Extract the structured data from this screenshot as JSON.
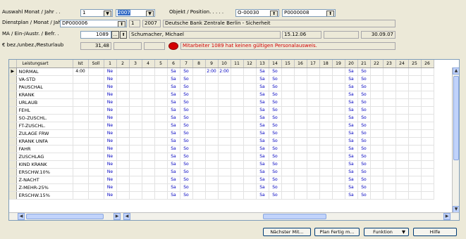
{
  "header": {
    "auswahl_label": "Auswahl Monat / Jahr . .",
    "month_value": "1",
    "year_value": "2007",
    "objekt_label": "Objekt / Position. . . . .",
    "objekt_value": "O-00030",
    "position_value": "P0000008",
    "dienstplan_label": "Dienstplan / Monat / Jahr",
    "dienstplan_value": "DP000006",
    "dp_month": "1",
    "dp_year": "2007",
    "dp_description": "Deutsche Bank Zentrale Berlin - Sicherheit",
    "ma_label": "MA / Ein-/Austr. / Befr. .",
    "ma_value": "1089",
    "ma_name": "Schumacher, Michael",
    "eintritt": "15.12.06",
    "austritt": "30.09.07",
    "urlaub_label": "€ bez./unbez./Resturlaub",
    "urlaub_value": "31,48",
    "warning_text": "Mitarbeiter 1089 hat keinen gültigen Personalausweis.",
    "warning_color": "#d40000"
  },
  "grid": {
    "columns": {
      "leistungsart": "Leistungsart",
      "ist": "Ist",
      "soll": "Soll",
      "days": [
        "1",
        "2",
        "3",
        "4",
        "5",
        "6",
        "7",
        "8",
        "9",
        "10",
        "11",
        "12",
        "13",
        "14",
        "15",
        "16",
        "17",
        "18",
        "19",
        "20",
        "21",
        "22",
        "23",
        "24",
        "25",
        "26"
      ]
    },
    "rows": [
      {
        "name": "NORMAL",
        "ist": "4:00",
        "soll": "",
        "cells": [
          "Ne",
          "",
          "",
          "",
          "",
          "Sa",
          "So",
          "",
          "2:00",
          "2:00",
          "",
          "",
          "Sa",
          "So",
          "",
          "",
          "",
          "",
          "",
          "Sa",
          "So",
          "",
          "",
          "",
          "",
          ""
        ]
      },
      {
        "name": "VA-STD",
        "ist": "",
        "soll": "",
        "cells": [
          "Ne",
          "",
          "",
          "",
          "",
          "Sa",
          "So",
          "",
          "",
          "",
          "",
          "",
          "Sa",
          "So",
          "",
          "",
          "",
          "",
          "",
          "Sa",
          "So",
          "",
          "",
          "",
          "",
          ""
        ]
      },
      {
        "name": "PAUSCHAL",
        "ist": "",
        "soll": "",
        "cells": [
          "Ne",
          "",
          "",
          "",
          "",
          "Sa",
          "So",
          "",
          "",
          "",
          "",
          "",
          "Sa",
          "So",
          "",
          "",
          "",
          "",
          "",
          "Sa",
          "So",
          "",
          "",
          "",
          "",
          ""
        ]
      },
      {
        "name": "KRANK",
        "ist": "",
        "soll": "",
        "cells": [
          "Ne",
          "",
          "",
          "",
          "",
          "Sa",
          "So",
          "",
          "",
          "",
          "",
          "",
          "Sa",
          "So",
          "",
          "",
          "",
          "",
          "",
          "Sa",
          "So",
          "",
          "",
          "",
          "",
          ""
        ]
      },
      {
        "name": "URLAUB",
        "ist": "",
        "soll": "",
        "cells": [
          "Ne",
          "",
          "",
          "",
          "",
          "Sa",
          "So",
          "",
          "",
          "",
          "",
          "",
          "Sa",
          "So",
          "",
          "",
          "",
          "",
          "",
          "Sa",
          "So",
          "",
          "",
          "",
          "",
          ""
        ]
      },
      {
        "name": "FEHL",
        "ist": "",
        "soll": "",
        "cells": [
          "Ne",
          "",
          "",
          "",
          "",
          "Sa",
          "So",
          "",
          "",
          "",
          "",
          "",
          "Sa",
          "So",
          "",
          "",
          "",
          "",
          "",
          "Sa",
          "So",
          "",
          "",
          "",
          "",
          ""
        ]
      },
      {
        "name": "SO-ZUSCHL.",
        "ist": "",
        "soll": "",
        "cells": [
          "Ne",
          "",
          "",
          "",
          "",
          "Sa",
          "So",
          "",
          "",
          "",
          "",
          "",
          "Sa",
          "So",
          "",
          "",
          "",
          "",
          "",
          "Sa",
          "So",
          "",
          "",
          "",
          "",
          ""
        ]
      },
      {
        "name": "FT-ZUSCHL.",
        "ist": "",
        "soll": "",
        "cells": [
          "Ne",
          "",
          "",
          "",
          "",
          "Sa",
          "So",
          "",
          "",
          "",
          "",
          "",
          "Sa",
          "So",
          "",
          "",
          "",
          "",
          "",
          "Sa",
          "So",
          "",
          "",
          "",
          "",
          ""
        ]
      },
      {
        "name": "ZULAGE FRW",
        "ist": "",
        "soll": "",
        "cells": [
          "Ne",
          "",
          "",
          "",
          "",
          "Sa",
          "So",
          "",
          "",
          "",
          "",
          "",
          "Sa",
          "So",
          "",
          "",
          "",
          "",
          "",
          "Sa",
          "So",
          "",
          "",
          "",
          "",
          ""
        ]
      },
      {
        "name": "KRANK UNFA",
        "ist": "",
        "soll": "",
        "cells": [
          "Ne",
          "",
          "",
          "",
          "",
          "Sa",
          "So",
          "",
          "",
          "",
          "",
          "",
          "Sa",
          "So",
          "",
          "",
          "",
          "",
          "",
          "Sa",
          "So",
          "",
          "",
          "",
          "",
          ""
        ]
      },
      {
        "name": "FAHR",
        "ist": "",
        "soll": "",
        "cells": [
          "Ne",
          "",
          "",
          "",
          "",
          "Sa",
          "So",
          "",
          "",
          "",
          "",
          "",
          "Sa",
          "So",
          "",
          "",
          "",
          "",
          "",
          "Sa",
          "So",
          "",
          "",
          "",
          "",
          ""
        ]
      },
      {
        "name": "ZUSCHLAG",
        "ist": "",
        "soll": "",
        "cells": [
          "Ne",
          "",
          "",
          "",
          "",
          "Sa",
          "So",
          "",
          "",
          "",
          "",
          "",
          "Sa",
          "So",
          "",
          "",
          "",
          "",
          "",
          "Sa",
          "So",
          "",
          "",
          "",
          "",
          ""
        ]
      },
      {
        "name": "KIND KRANK",
        "ist": "",
        "soll": "",
        "cells": [
          "Ne",
          "",
          "",
          "",
          "",
          "Sa",
          "So",
          "",
          "",
          "",
          "",
          "",
          "Sa",
          "So",
          "",
          "",
          "",
          "",
          "",
          "Sa",
          "So",
          "",
          "",
          "",
          "",
          ""
        ]
      },
      {
        "name": "ERSCHW.10%",
        "ist": "",
        "soll": "",
        "cells": [
          "Ne",
          "",
          "",
          "",
          "",
          "Sa",
          "So",
          "",
          "",
          "",
          "",
          "",
          "Sa",
          "So",
          "",
          "",
          "",
          "",
          "",
          "Sa",
          "So",
          "",
          "",
          "",
          "",
          ""
        ]
      },
      {
        "name": "Z-NACHT",
        "ist": "",
        "soll": "",
        "cells": [
          "Ne",
          "",
          "",
          "",
          "",
          "Sa",
          "So",
          "",
          "",
          "",
          "",
          "",
          "Sa",
          "So",
          "",
          "",
          "",
          "",
          "",
          "Sa",
          "So",
          "",
          "",
          "",
          "",
          ""
        ]
      },
      {
        "name": "Z-MEHR-25%",
        "ist": "",
        "soll": "",
        "cells": [
          "Ne",
          "",
          "",
          "",
          "",
          "Sa",
          "So",
          "",
          "",
          "",
          "",
          "",
          "Sa",
          "So",
          "",
          "",
          "",
          "",
          "",
          "Sa",
          "So",
          "",
          "",
          "",
          "",
          ""
        ]
      },
      {
        "name": "ERSCHW.15%",
        "ist": "",
        "soll": "",
        "cells": [
          "Ne",
          "",
          "",
          "",
          "",
          "Sa",
          "So",
          "",
          "",
          "",
          "",
          "",
          "Sa",
          "So",
          "",
          "",
          "",
          "",
          "",
          "Sa",
          "So",
          "",
          "",
          "",
          "",
          ""
        ]
      }
    ]
  },
  "buttons": {
    "naechster": "Nächster Mit...",
    "plan_fertig": "Plan Fertig m...",
    "funktion": "Funktion",
    "hilfe": "Hilfe"
  },
  "icons": {
    "dropdown": "chevron-down-icon",
    "lookup": "lookup-arrow-icon",
    "row_pointer": "row-pointer-icon",
    "warning": "warning-dot-icon"
  }
}
